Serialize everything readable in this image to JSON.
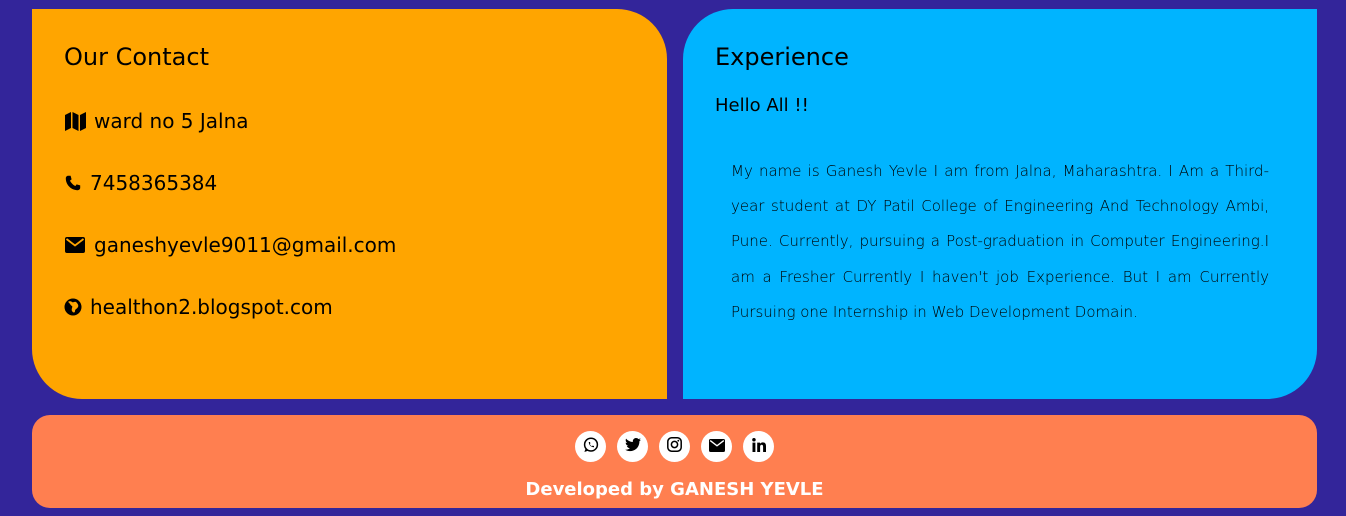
{
  "contact": {
    "title": "Our Contact",
    "items": [
      {
        "icon": "map-icon",
        "text": "ward no 5 Jalna"
      },
      {
        "icon": "phone-icon",
        "text": "7458365384"
      },
      {
        "icon": "envelope-icon",
        "text": "ganeshyevle9011@gmail.com"
      },
      {
        "icon": "globe-icon",
        "text": "healthon2.blogspot.com"
      }
    ]
  },
  "experience": {
    "title": "Experience",
    "greeting": "Hello All !!",
    "body": "My name is Ganesh Yevle I am from Jalna, Maharashtra. I Am a Third-year student at DY Patil College of Engineering And Technology Ambi, Pune. Currently, pursuing a Post-graduation in Computer Engineering.I am a Fresher Currently I haven't job Experience. But I am Currently Pursuing one Internship in Web Development Domain."
  },
  "footer": {
    "social": [
      "whatsapp-icon",
      "twitter-icon",
      "instagram-icon",
      "envelope-icon",
      "linkedin-icon"
    ],
    "credit": "Developed by GANESH YEVLE"
  },
  "colors": {
    "background": "#33259a",
    "contact_card": "#ffa500",
    "experience_card": "#00b4ff",
    "footer": "#ff7f50"
  }
}
